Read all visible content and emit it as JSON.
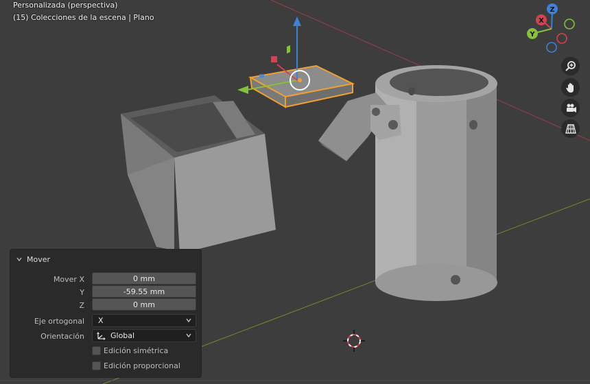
{
  "viewport": {
    "view_name": "Personalizada (perspectiva)",
    "collection_info": "(15) Colecciones de la escena | Plano"
  },
  "gizmo": {
    "z": "Z",
    "y": "Y",
    "x": "X"
  },
  "navigation": [
    "zoom-icon",
    "hand-pan-icon",
    "camera-icon",
    "grid-perspective-icon"
  ],
  "operator_panel": {
    "title": "Mover",
    "fields": [
      {
        "label": "Mover X",
        "value": "0 mm"
      },
      {
        "label": "Y",
        "value": "-59.55 mm"
      },
      {
        "label": "Z",
        "value": "0 mm"
      }
    ],
    "constraint_axis": {
      "label": "Eje ortogonal",
      "value": "X"
    },
    "orientation": {
      "label": "Orientación",
      "value": "Global"
    },
    "symmetric_edit": {
      "label": "Edición simétrica",
      "checked": false
    },
    "proportional_edit": {
      "label": "Edición proporcional",
      "checked": false
    }
  },
  "colors": {
    "background": "#3d3d3d",
    "x_axis": "#d4424f",
    "y_axis": "#86c13a",
    "z_axis": "#3b82d9",
    "selection": "#f0a030"
  }
}
